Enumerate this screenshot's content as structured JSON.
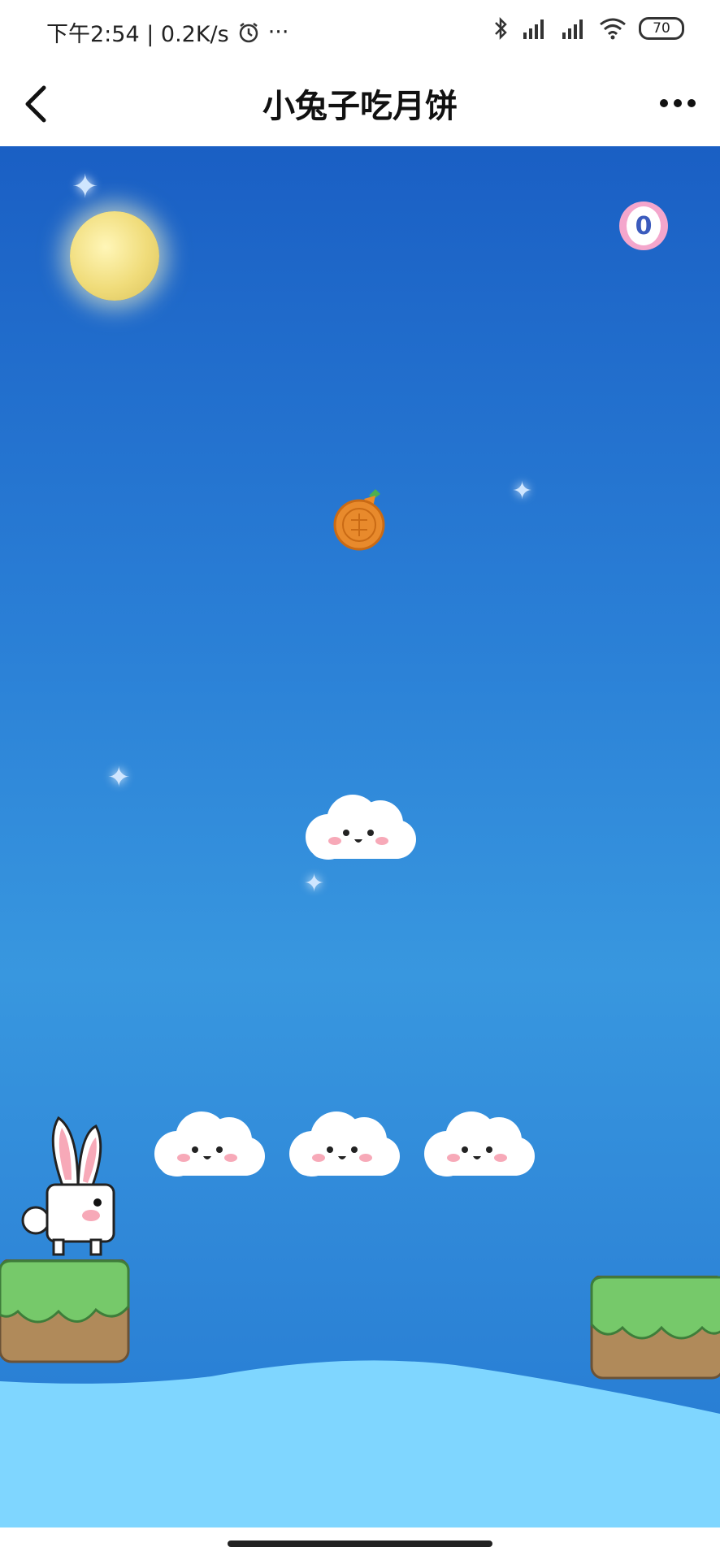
{
  "status_bar": {
    "time_and_speed": "下午2:54 | 0.2K/s",
    "ellipsis": "···",
    "battery": "70"
  },
  "nav": {
    "title": "小兔子吃月饼"
  },
  "game": {
    "score": "0",
    "clouds_count": 4
  },
  "colors": {
    "sky_top": "#1a5fc4",
    "water": "#7fd6ff",
    "grass": "#76c96a",
    "dirt": "#b08a5a"
  }
}
